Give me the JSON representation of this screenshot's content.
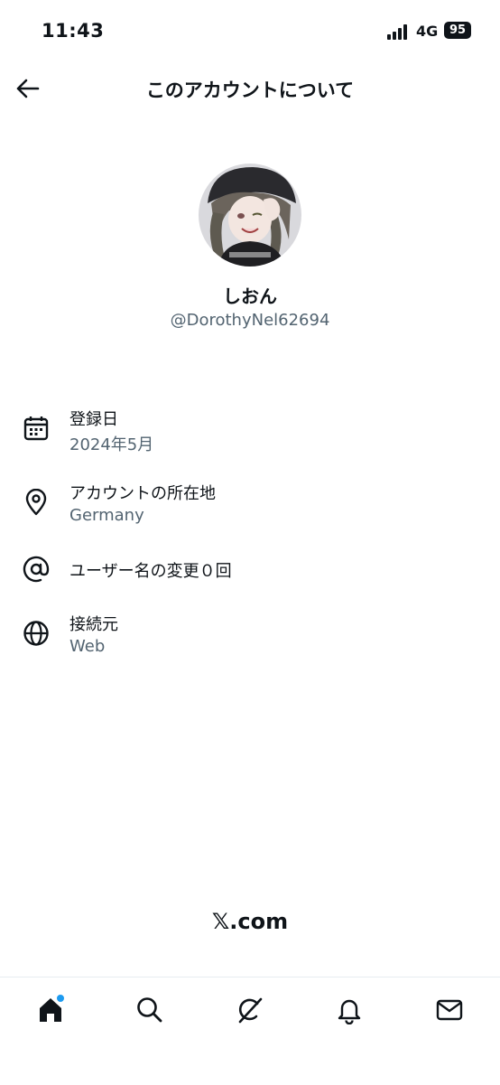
{
  "status_bar": {
    "time": "11:43",
    "network": "4G",
    "battery": "95"
  },
  "header": {
    "title": "このアカウントについて",
    "back_icon": "arrow-left-icon"
  },
  "profile": {
    "name": "しおん",
    "handle": "@DorothyNel62694"
  },
  "info": {
    "joined": {
      "label": "登録日",
      "value": "2024年5月",
      "icon": "calendar-icon"
    },
    "location": {
      "label": "アカウントの所在地",
      "value": "Germany",
      "icon": "location-pin-icon"
    },
    "username_changes": {
      "label": "ユーザー名の変更０回",
      "icon": "at-sign-icon"
    },
    "connected_via": {
      "label": "接続元",
      "value": "Web",
      "icon": "globe-icon"
    }
  },
  "footer": {
    "brand": "𝕏.com"
  },
  "tabbar": {
    "items": [
      "home-icon",
      "search-icon",
      "grok-icon",
      "notifications-icon",
      "messages-icon"
    ],
    "accent": "#1d9bf0"
  }
}
